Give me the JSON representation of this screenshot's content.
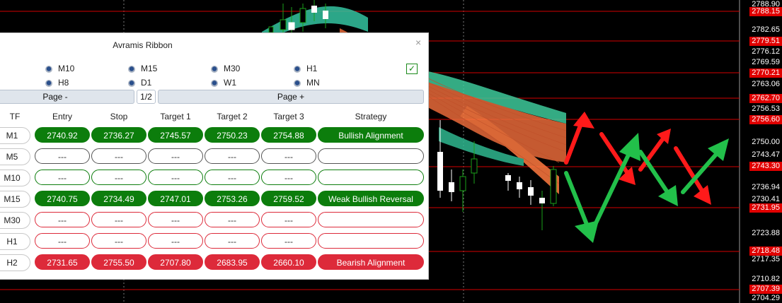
{
  "panel": {
    "title": "Avramis Ribbon",
    "close_icon": "×",
    "timeframes_row1": [
      "M10",
      "M15",
      "M30",
      "H1"
    ],
    "timeframes_row2": [
      "H8",
      "D1",
      "W1",
      "MN"
    ],
    "checkbox_checked": true,
    "page_prev_label": "Page -",
    "page_indicator": "1/2",
    "page_next_label": "Page +",
    "headers": [
      "TF",
      "Entry",
      "Stop",
      "Target 1",
      "Target 2",
      "Target 3",
      "Strategy"
    ],
    "rows": [
      {
        "tf": "M1",
        "style": "g",
        "entry": "2740.92",
        "stop": "2736.27",
        "t1": "2745.57",
        "t2": "2750.23",
        "t3": "2754.88",
        "strategy": "Bullish Alignment"
      },
      {
        "tf": "M5",
        "style": "e-gray",
        "entry": "---",
        "stop": "---",
        "t1": "---",
        "t2": "---",
        "t3": "---",
        "strategy": ""
      },
      {
        "tf": "M10",
        "style": "e-green",
        "entry": "---",
        "stop": "---",
        "t1": "---",
        "t2": "---",
        "t3": "---",
        "strategy": ""
      },
      {
        "tf": "M15",
        "style": "g",
        "entry": "2740.75",
        "stop": "2734.49",
        "t1": "2747.01",
        "t2": "2753.26",
        "t3": "2759.52",
        "strategy": "Weak Bullish Reversal"
      },
      {
        "tf": "M30",
        "style": "e-red",
        "entry": "---",
        "stop": "---",
        "t1": "---",
        "t2": "---",
        "t3": "---",
        "strategy": ""
      },
      {
        "tf": "H1",
        "style": "e-red",
        "entry": "---",
        "stop": "---",
        "t1": "---",
        "t2": "---",
        "t3": "---",
        "strategy": ""
      },
      {
        "tf": "H2",
        "style": "r",
        "entry": "2731.65",
        "stop": "2755.50",
        "t1": "2707.80",
        "t2": "2683.95",
        "t3": "2660.10",
        "strategy": "Bearish Alignment"
      }
    ]
  },
  "price_axis": {
    "white_labels": [
      "2788.90",
      "2782.65",
      "2776.12",
      "2769.59",
      "2763.06",
      "2756.53",
      "2750.00",
      "2743.47",
      "2736.94",
      "2730.41",
      "2723.88",
      "2717.35",
      "2710.82",
      "2704.29"
    ],
    "red_labels": [
      "2788.15",
      "2779.51",
      "2770.21",
      "2762.70",
      "2756.60",
      "2743.30",
      "2731.95",
      "2718.48",
      "2707.39"
    ]
  },
  "colors": {
    "up": "#0c7d0c",
    "down": "#dd2a3a",
    "level_line": "#d40000",
    "arrow_up": "#22c04a",
    "arrow_down": "#ff1a1a"
  }
}
